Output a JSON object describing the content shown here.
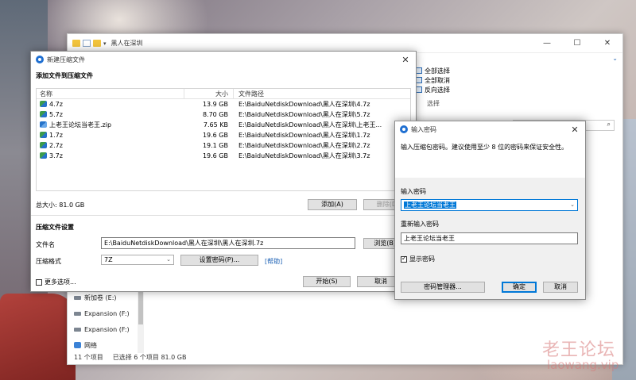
{
  "explorer": {
    "title": "黑人在深圳",
    "min": "—",
    "max": "☐",
    "close": "✕",
    "expand": "⌄",
    "ribbon": [
      "全部选择",
      "全部取消",
      "反向选择"
    ],
    "ribbon_group": "选择",
    "search_icon": "⌕",
    "nav": [
      {
        "label": "新加卷 (E:)",
        "icon": "drive-icon"
      },
      {
        "label": "Expansion (F:)",
        "icon": "drive-icon"
      },
      {
        "label": "Expansion (F:)",
        "icon": "drive-icon"
      },
      {
        "label": "网络",
        "icon": "network-icon"
      }
    ],
    "status": {
      "count": "11 个项目",
      "selected": "已选择 6 个项目  81.0 GB"
    }
  },
  "compress_dialog": {
    "title": "新建压缩文件",
    "close": "✕",
    "add_section": "添加文件到压缩文件",
    "columns": {
      "name": "名称",
      "size": "大小",
      "path": "文件路径"
    },
    "files": [
      {
        "name": "4.7z",
        "size": "13.9 GB",
        "path": "E:\\BaiduNetdiskDownload\\黑人在深圳\\4.7z",
        "icon": "7z"
      },
      {
        "name": "5.7z",
        "size": "8.70 GB",
        "path": "E:\\BaiduNetdiskDownload\\黑人在深圳\\5.7z",
        "icon": "7z"
      },
      {
        "name": "上老王论坛当老王.zip",
        "size": "7.65 KB",
        "path": "E:\\BaiduNetdiskDownload\\黑人在深圳\\上老王...",
        "icon": "zip"
      },
      {
        "name": "1.7z",
        "size": "19.6 GB",
        "path": "E:\\BaiduNetdiskDownload\\黑人在深圳\\1.7z",
        "icon": "7z"
      },
      {
        "name": "2.7z",
        "size": "19.1 GB",
        "path": "E:\\BaiduNetdiskDownload\\黑人在深圳\\2.7z",
        "icon": "7z"
      },
      {
        "name": "3.7z",
        "size": "19.6 GB",
        "path": "E:\\BaiduNetdiskDownload\\黑人在深圳\\3.7z",
        "icon": "7z"
      }
    ],
    "total": "总大小: 81.0 GB",
    "add_button": "添加(A)",
    "delete_button": "删除(D)",
    "settings_section": "压缩文件设置",
    "filename_label": "文件名",
    "filename_value": "E:\\BaiduNetdiskDownload\\黑人在深圳\\黑人在深圳.7z",
    "browse_button": "浏览(B)...",
    "format_label": "压缩格式",
    "format_value": "7Z",
    "set_password_button": "设置密码(P)...",
    "help_link": "[帮助]",
    "more_options": "更多选项...",
    "start_button": "开始(S)",
    "cancel_button": "取消"
  },
  "password_dialog": {
    "title": "输入密码",
    "close": "✕",
    "instruction": "输入压缩包密码。建议使用至少 8 位的密码来保证安全性。",
    "password_label": "输入密码",
    "password_value": "上老王论坛当老王",
    "confirm_label": "重新输入密码",
    "confirm_value": "上老王论坛当老王",
    "show_password": "显示密码",
    "show_password_checked": true,
    "manager_button": "密码管理器...",
    "ok_button": "确定",
    "cancel_button": "取消"
  },
  "watermark": {
    "title": "老王论坛",
    "site": "laowang.vip"
  },
  "colors": {
    "accent": "#0078d7",
    "link": "#1a5fb4",
    "watermark": "#d77878"
  }
}
